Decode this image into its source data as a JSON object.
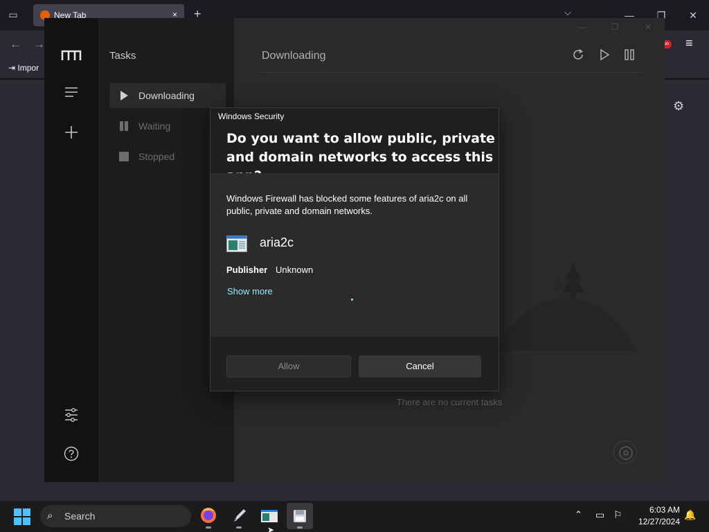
{
  "browser": {
    "tab_title": "New Tab",
    "tab_close": "×",
    "new_tab": "+",
    "import_label": "Impor",
    "ext_badge": "uo",
    "window_controls": [
      "—",
      "❐",
      "✕"
    ]
  },
  "motrix": {
    "sidebar_title": "Tasks",
    "sidebar_items": [
      {
        "label": "Downloading",
        "active": true
      },
      {
        "label": "Waiting",
        "active": false
      },
      {
        "label": "Stopped",
        "active": false
      }
    ],
    "main_title": "Downloading",
    "empty_text": "There are no current tasks",
    "toolbar_icons": [
      "refresh-icon",
      "play-icon",
      "pause-icon"
    ]
  },
  "dialog": {
    "caption": "Windows Security",
    "title": "Do you want to allow public, private and domain networks to access this app?",
    "description": "Windows Firewall has blocked some features of aria2c on all public, private and domain networks.",
    "app_name": "aria2c",
    "publisher_label": "Publisher",
    "publisher_value": "Unknown",
    "show_more": "Show more",
    "allow_label": "Allow",
    "cancel_label": "Cancel"
  },
  "taskbar": {
    "search_placeholder": "Search",
    "time": "6:03 AM",
    "date": "12/27/2024",
    "accent": "#4cc2ff"
  }
}
